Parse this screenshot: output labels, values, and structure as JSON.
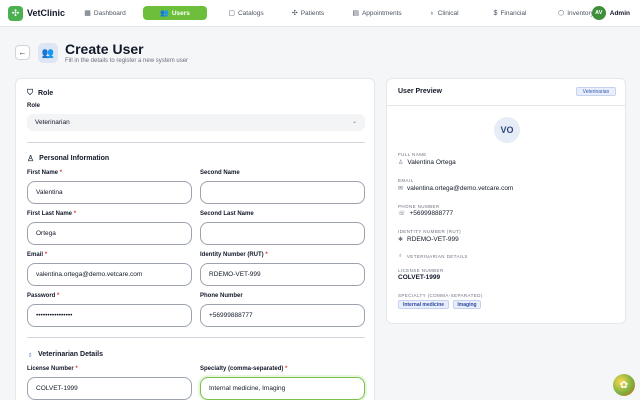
{
  "brand": {
    "name": "VetClinic",
    "logo_icon": "paw-icon"
  },
  "nav": {
    "items": [
      {
        "label": "Dashboard",
        "icon": "grid-icon",
        "glyph": "▦",
        "active": false
      },
      {
        "label": "Users",
        "icon": "users-icon",
        "glyph": "👥",
        "active": true
      },
      {
        "label": "Catalogs",
        "icon": "book-icon",
        "glyph": "▢",
        "active": false
      },
      {
        "label": "Patients",
        "icon": "paw-icon",
        "glyph": "✣",
        "active": false
      },
      {
        "label": "Appointments",
        "icon": "calendar-icon",
        "glyph": "▤",
        "active": false
      },
      {
        "label": "Clinical",
        "icon": "stethoscope-icon",
        "glyph": "♁",
        "active": false
      },
      {
        "label": "Financial",
        "icon": "dollar-icon",
        "glyph": "$",
        "active": false
      },
      {
        "label": "Inventory",
        "icon": "box-icon",
        "glyph": "⬡",
        "active": false
      }
    ],
    "user": {
      "initials": "AV",
      "name": "Admin"
    }
  },
  "header": {
    "title": "Create User",
    "subtitle": "Fill in the details to register a new system user"
  },
  "form": {
    "role_section": "Role",
    "role_label": "Role",
    "role_value": "Veterinarian",
    "personal_section": "Personal Information",
    "first_name": {
      "label": "First Name",
      "value": "Valentina",
      "required": "*"
    },
    "second_name": {
      "label": "Second Name",
      "value": ""
    },
    "first_last_name": {
      "label": "First Last Name",
      "value": "Ortega",
      "required": "*"
    },
    "second_last_name": {
      "label": "Second Last Name",
      "value": ""
    },
    "email": {
      "label": "Email",
      "value": "valentina.ortega@demo.vetcare.com",
      "required": "*"
    },
    "identity": {
      "label": "Identity Number (RUT)",
      "value": "RDEMO-VET-999",
      "required": "*"
    },
    "password": {
      "label": "Password",
      "value": "••••••••••••••••",
      "required": "*"
    },
    "phone": {
      "label": "Phone Number",
      "value": "+56999888777"
    },
    "vet_section": "Veterinarian Details",
    "license": {
      "label": "License Number",
      "value": "COLVET-1999",
      "required": "*"
    },
    "specialty": {
      "label": "Specialty (comma-separated)",
      "value": "Internal medicine, Imaging",
      "required": "*"
    }
  },
  "preview": {
    "title": "User Preview",
    "role_badge": "Veterinarian",
    "initials": "VO",
    "full_name_label": "Full Name",
    "full_name": "Valentina Ortega",
    "email_label": "Email",
    "email": "valentina.ortega@demo.vetcare.com",
    "phone_label": "Phone Number",
    "phone": "+56999888777",
    "identity_label": "Identity Number (RUT)",
    "identity": "RDEMO-VET-999",
    "vet_details_label": "Veterinarian Details",
    "license_label": "License Number",
    "license": "COLVET-1999",
    "specialty_label": "Specialty (comma-separated)",
    "specialty_tags": [
      "Internal medicine",
      "Imaging"
    ]
  },
  "colors": {
    "accent": "#6dbf3b",
    "required": "#e53935",
    "badge": "#e8eefb"
  }
}
